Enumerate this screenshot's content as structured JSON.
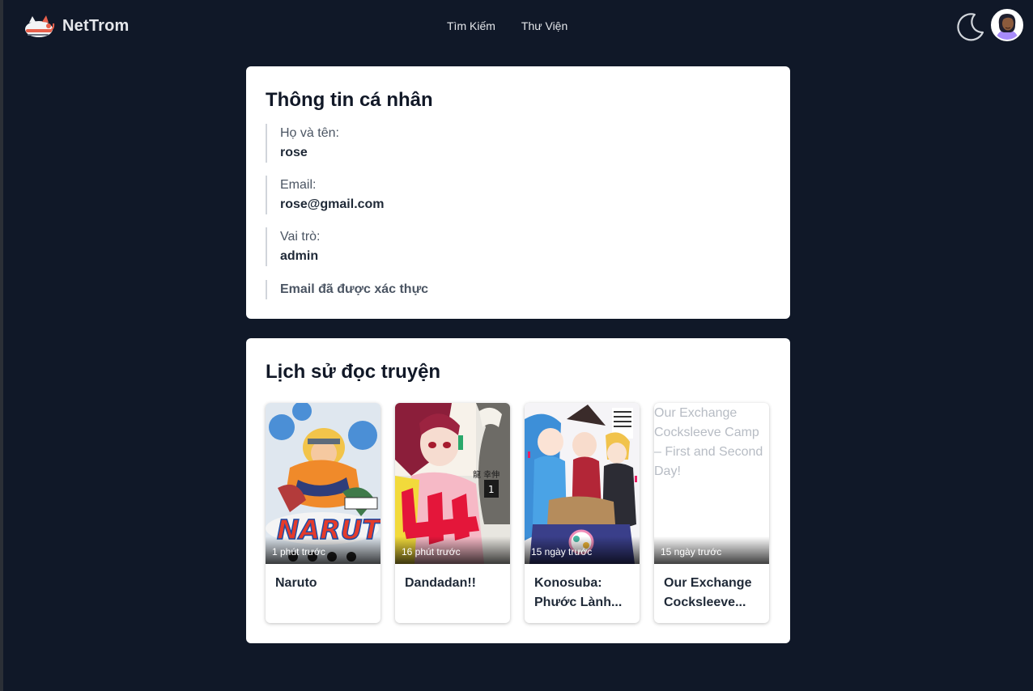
{
  "app": {
    "name": "NetTrom"
  },
  "nav": {
    "search_label": "Tìm Kiếm",
    "library_label": "Thư Viện"
  },
  "profile": {
    "heading": "Thông tin cá nhân",
    "name_label": "Họ và tên:",
    "name_value": "rose",
    "email_label": "Email:",
    "email_value": "rose@gmail.com",
    "role_label": "Vai trò:",
    "role_value": "admin",
    "verified_text": "Email đã được xác thực"
  },
  "history": {
    "heading": "Lịch sử đọc truyện",
    "items": [
      {
        "title": "Naruto",
        "time": "1 phút trước",
        "cover_alt": ""
      },
      {
        "title": "Dandadan!!",
        "time": "16 phút trước",
        "cover_alt": ""
      },
      {
        "title": "Konosuba: Phước Lành...",
        "time": "15 ngày trước",
        "cover_alt": ""
      },
      {
        "title": "Our Exchange Cocksleeve...",
        "time": "15 ngày trước",
        "cover_alt": "Our Exchange Cocksleeve Camp – First and Second Day!"
      }
    ]
  },
  "colors": {
    "background": "#101828",
    "card": "#ffffff",
    "accent": "#e8604c"
  },
  "icons": {
    "theme_toggle": "moon-icon",
    "logo": "cat-logo-icon"
  }
}
